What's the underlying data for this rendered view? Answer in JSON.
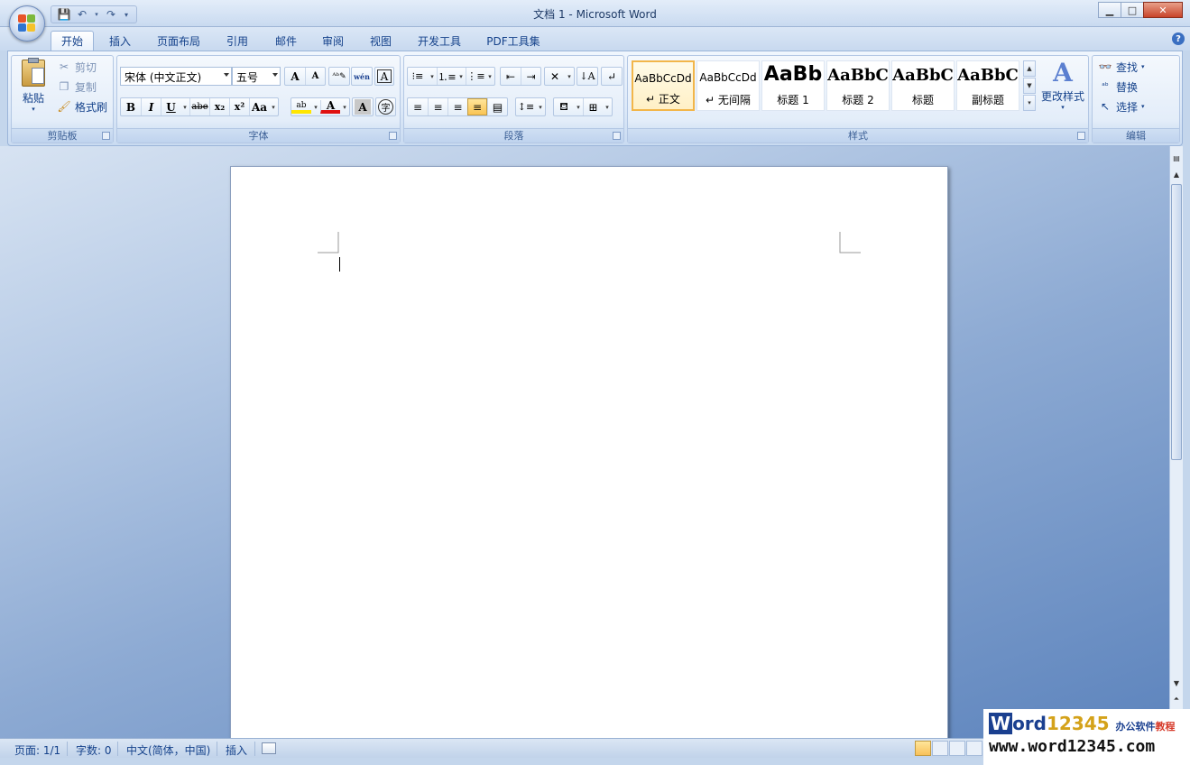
{
  "window": {
    "title": "文档 1 - Microsoft Word",
    "minimize_label": "▁",
    "maximize_label": "□",
    "close_label": "✕"
  },
  "tabs": [
    "开始",
    "插入",
    "页面布局",
    "引用",
    "邮件",
    "审阅",
    "视图",
    "开发工具",
    "PDF工具集"
  ],
  "active_tab": "开始",
  "ribbon": {
    "clipboard": {
      "label": "剪贴板",
      "paste": "粘贴",
      "cut": "剪切",
      "copy": "复制",
      "format_painter": "格式刷"
    },
    "font": {
      "label": "字体",
      "font_name": "宋体 (中文正文)",
      "font_size": "五号",
      "bold": "B",
      "italic": "I",
      "underline": "U",
      "strike": "abe",
      "subscript": "x₂",
      "superscript": "x²",
      "change_case": "Aa",
      "grow": "A",
      "shrink": "A",
      "font_color": "A",
      "char_shading": "A",
      "enclose": "字",
      "border": "A",
      "phonetic": "wén",
      "highlight": "ab"
    },
    "paragraph": {
      "label": "段落"
    },
    "styles": {
      "label": "样式",
      "items": [
        {
          "sample": "AaBbCcDd",
          "name": "正文"
        },
        {
          "sample": "AaBbCcDd",
          "name": "无间隔"
        },
        {
          "sample": "AaBb",
          "name": "标题 1"
        },
        {
          "sample": "AaBbC",
          "name": "标题 2"
        },
        {
          "sample": "AaBbC",
          "name": "标题"
        },
        {
          "sample": "AaBbC",
          "name": "副标题"
        }
      ],
      "change_styles": "更改样式"
    },
    "editing": {
      "label": "编辑",
      "find": "查找",
      "replace": "替换",
      "select": "选择"
    }
  },
  "status": {
    "page": "页面: 1/1",
    "words": "字数: 0",
    "language": "中文(简体，中国)",
    "mode": "插入"
  },
  "watermark": {
    "w": "W",
    "ord": "ord",
    "num": "12345",
    "cn1": "办公软件",
    "cn2": "教程",
    "url": "www.word12345.com"
  }
}
